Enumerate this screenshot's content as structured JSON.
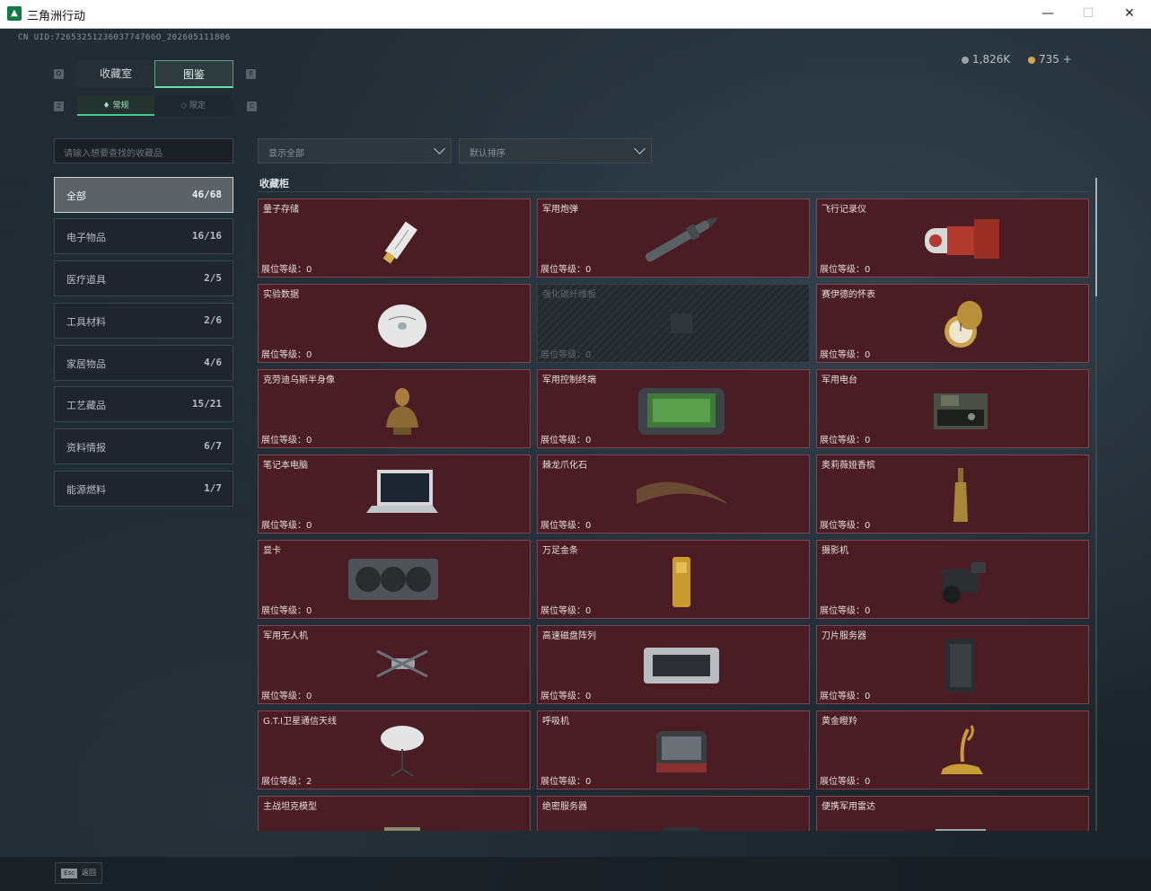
{
  "window": {
    "title": "三角洲行动",
    "minimize": "—",
    "maximize": "☐",
    "close": "✕"
  },
  "uid": "CN UID:7265325123603774766O_202605111806",
  "currency": {
    "coins": "1,826K",
    "gems": "735 +"
  },
  "tabs": {
    "collection": "收藏室",
    "atlas": "图鉴"
  },
  "subtabs": {
    "normal": "常规",
    "limited": "限定"
  },
  "keyhints": {
    "q": "Q",
    "e": "E",
    "z": "Z",
    "c": "C"
  },
  "search": {
    "placeholder": "请输入想要查找的收藏品"
  },
  "categories": [
    {
      "label": "全部",
      "count": "46/68"
    },
    {
      "label": "电子物品",
      "count": "16/16"
    },
    {
      "label": "医疗道具",
      "count": "2/5"
    },
    {
      "label": "工具材料",
      "count": "2/6"
    },
    {
      "label": "家居物品",
      "count": "4/6"
    },
    {
      "label": "工艺藏品",
      "count": "15/21"
    },
    {
      "label": "资料情报",
      "count": "6/7"
    },
    {
      "label": "能源燃料",
      "count": "1/7"
    }
  ],
  "filters": {
    "show": "显示全部",
    "sort": "默认排序"
  },
  "section_title": "收藏柜",
  "items": [
    {
      "name": "量子存储",
      "level": "展位等级：0",
      "icon": "usb-drive-icon"
    },
    {
      "name": "军用炮弹",
      "level": "展位等级：0",
      "icon": "artillery-shell-icon"
    },
    {
      "name": "飞行记录仪",
      "level": "展位等级：0",
      "icon": "flight-recorder-icon"
    },
    {
      "name": "实验数据",
      "level": "展位等级：0",
      "icon": "data-disc-icon"
    },
    {
      "name": "强化碳纤维板",
      "level": "展位等级：0",
      "icon": "locked-item-icon"
    },
    {
      "name": "赛伊德的怀表",
      "level": "展位等级：0",
      "icon": "pocket-watch-icon"
    },
    {
      "name": "克劳迪乌斯半身像",
      "level": "展位等级：0",
      "icon": "bust-statue-icon"
    },
    {
      "name": "军用控制终端",
      "level": "展位等级：0",
      "icon": "control-terminal-icon"
    },
    {
      "name": "军用电台",
      "level": "展位等级：0",
      "icon": "military-radio-icon"
    },
    {
      "name": "笔记本电脑",
      "level": "展位等级：0",
      "icon": "laptop-icon"
    },
    {
      "name": "棘龙爪化石",
      "level": "展位等级：0",
      "icon": "claw-fossil-icon"
    },
    {
      "name": "奥莉薇娅香槟",
      "level": "展位等级：0",
      "icon": "champagne-bottle-icon"
    },
    {
      "name": "显卡",
      "level": "展位等级：0",
      "icon": "graphics-card-icon"
    },
    {
      "name": "万足金条",
      "level": "展位等级：0",
      "icon": "gold-bar-icon"
    },
    {
      "name": "摄影机",
      "level": "展位等级：0",
      "icon": "video-camera-icon"
    },
    {
      "name": "军用无人机",
      "level": "展位等级：0",
      "icon": "drone-icon"
    },
    {
      "name": "高速磁盘阵列",
      "level": "展位等级：0",
      "icon": "disk-array-icon"
    },
    {
      "name": "刀片服务器",
      "level": "展位等级：0",
      "icon": "blade-server-icon"
    },
    {
      "name": "G.T.I卫星通信天线",
      "level": "展位等级：2",
      "icon": "satellite-dish-icon"
    },
    {
      "name": "呼吸机",
      "level": "展位等级：0",
      "icon": "ventilator-icon"
    },
    {
      "name": "黄金瞪羚",
      "level": "展位等级：0",
      "icon": "golden-gazelle-icon"
    },
    {
      "name": "主战坦克模型",
      "level": "",
      "icon": "tank-model-icon"
    },
    {
      "name": "绝密服务器",
      "level": "",
      "icon": "secret-server-icon"
    },
    {
      "name": "便携军用雷达",
      "level": "",
      "icon": "portable-radar-icon"
    }
  ],
  "footer": {
    "esc_key": "Esc",
    "esc_label": "返回"
  },
  "colors": {
    "card_bg": "#4a1d24",
    "card_border": "#7a4650",
    "accent": "#45c98d"
  }
}
